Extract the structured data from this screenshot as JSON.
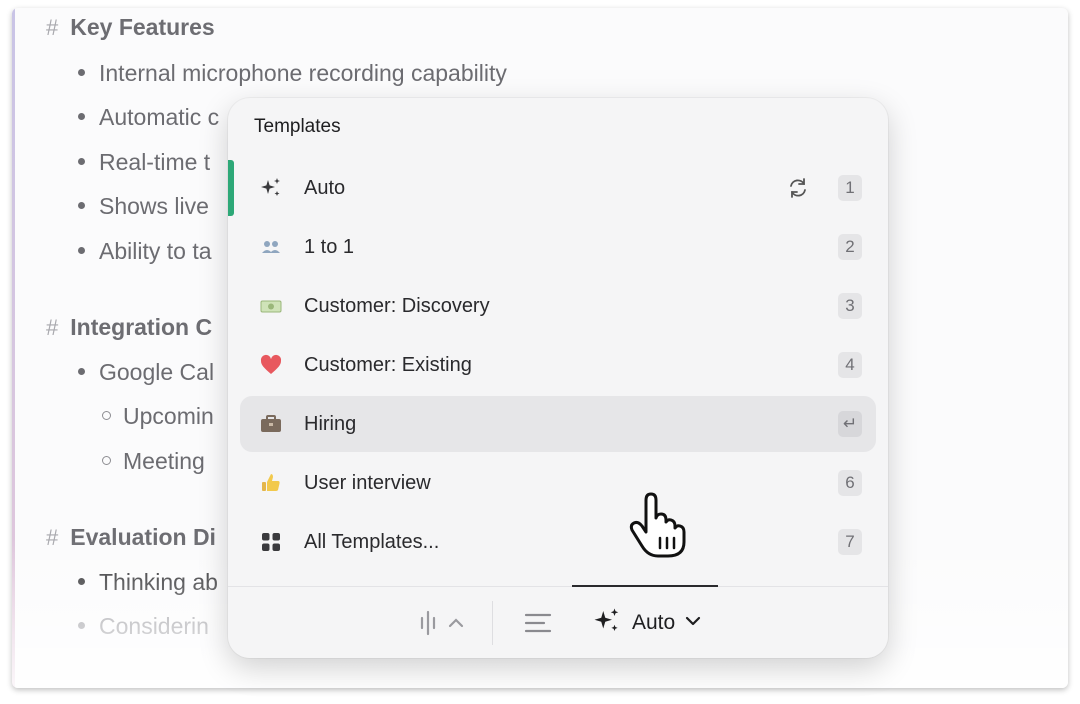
{
  "document": {
    "sections": [
      {
        "heading": "Key Features",
        "bullets": [
          "Internal microphone recording capability",
          "Automatic c",
          "Real-time t",
          "Shows live",
          "Ability to ta"
        ]
      },
      {
        "heading": "Integration C",
        "bullets": [
          "Google Cal"
        ],
        "subbullets": [
          "Upcomin",
          "Meeting"
        ]
      },
      {
        "heading": "Evaluation Di",
        "bullets": [
          "Thinking ab",
          "Considerin"
        ]
      }
    ],
    "hash_symbol": "#"
  },
  "templates_popup": {
    "title": "Templates",
    "items": [
      {
        "label": "Auto",
        "icon": "sparkles-icon",
        "key": "1"
      },
      {
        "label": "1 to 1",
        "icon": "people-icon",
        "key": "2"
      },
      {
        "label": "Customer: Discovery",
        "icon": "money-icon",
        "key": "3"
      },
      {
        "label": "Customer: Existing",
        "icon": "heart-icon",
        "key": "4"
      },
      {
        "label": "Hiring",
        "icon": "briefcase-icon",
        "key": "↵"
      },
      {
        "label": "User interview",
        "icon": "thumbs-up-icon",
        "key": "6"
      },
      {
        "label": "All Templates...",
        "icon": "grid-icon",
        "key": "7"
      }
    ],
    "footer": {
      "template_selector_label": "Auto"
    },
    "colors": {
      "active_accent": "#2da877",
      "heart": "#e8585e"
    }
  }
}
